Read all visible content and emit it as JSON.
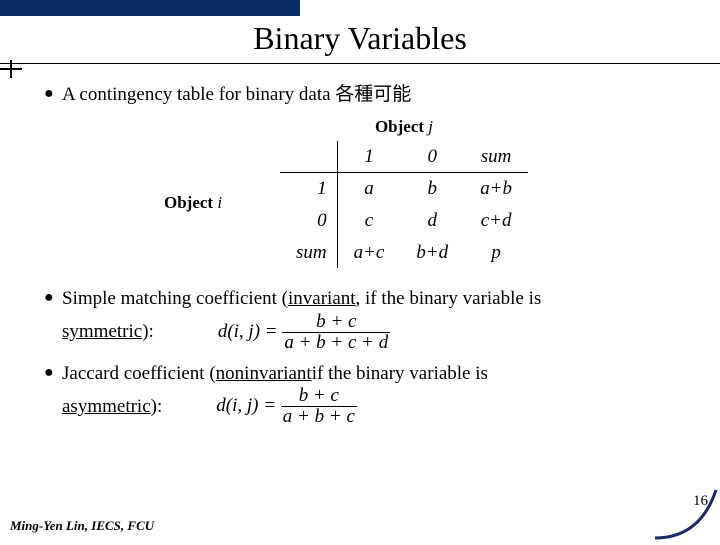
{
  "title": "Binary Variables",
  "bullets": {
    "b1": "A contingency table for binary data 各種可能",
    "b2_a": "Simple matching coefficient (",
    "b2_b": "invariant",
    "b2_c": ", if the binary variable is ",
    "b2_d": "symmetric",
    "b2_e": "):",
    "b3_a": "Jaccard coefficient (",
    "b3_b": "noninvariant",
    "b3_c": " if the binary variable is ",
    "b3_d": "asymmetric",
    "b3_e": "):"
  },
  "table": {
    "obj_j_label": "Object ",
    "obj_j_var": "j",
    "obj_i_label": "Object ",
    "obj_i_var": "i",
    "c_1": "1",
    "c_0": "0",
    "c_sum": "sum",
    "r1_lead": "1",
    "r1_a": "a",
    "r1_b": "b",
    "r1_s": "a+b",
    "r2_lead": "0",
    "r2_a": "c",
    "r2_b": "d",
    "r2_s": "c+d",
    "r3_lead": "sum",
    "r3_a": "a+c",
    "r3_b": "b+d",
    "r3_s": "p"
  },
  "eq1": {
    "lhs": "d(i, j) = ",
    "num": "b + c",
    "den": "a + b + c + d"
  },
  "eq2": {
    "lhs": "d(i, j) = ",
    "num": "b + c",
    "den": "a + b + c"
  },
  "page_number": "16",
  "footer": "Ming-Yen Lin, IECS, FCU"
}
